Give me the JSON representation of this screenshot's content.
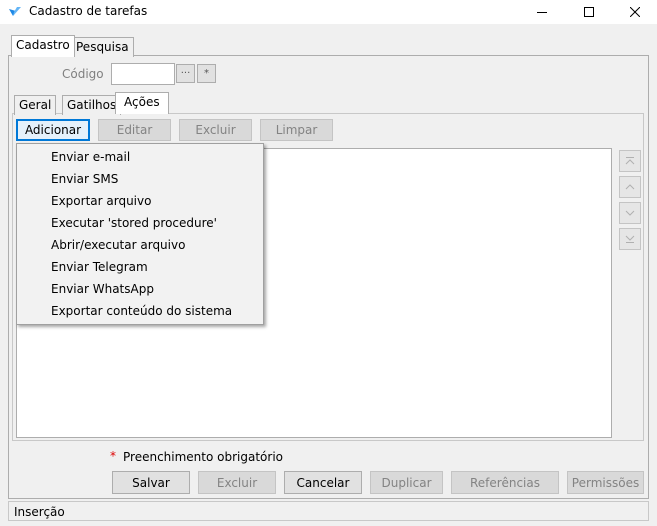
{
  "window": {
    "title": "Cadastro de tarefas",
    "icon": "app-logo-icon",
    "accent_color": "#0078d7"
  },
  "top_tabs": [
    {
      "label": "Cadastro",
      "active": true
    },
    {
      "label": "Pesquisa",
      "active": false
    }
  ],
  "codigo": {
    "label": "Código",
    "value": "",
    "ellipsis_button": "···",
    "star_button": "*"
  },
  "sub_tabs": [
    {
      "label": "Geral",
      "active": false
    },
    {
      "label": "Gatilhos",
      "active": false
    },
    {
      "label": "Ações",
      "active": true
    }
  ],
  "toolbar": {
    "adicionar": "Adicionar",
    "editar": "Editar",
    "excluir": "Excluir",
    "limpar": "Limpar"
  },
  "dropdown_menu": [
    "Enviar e-mail",
    "Enviar SMS",
    "Exportar arquivo",
    "Executar 'stored procedure'",
    "Abrir/executar arquivo",
    "Enviar Telegram",
    "Enviar WhatsApp",
    "Exportar conteúdo do sistema"
  ],
  "reorder_buttons": [
    "move-top-icon",
    "move-up-icon",
    "move-down-icon",
    "move-bottom-icon"
  ],
  "required_note": {
    "star": "*",
    "text": "Preenchimento obrigatório"
  },
  "bottom_buttons": {
    "salvar": "Salvar",
    "excluir": "Excluir",
    "cancelar": "Cancelar",
    "duplicar": "Duplicar",
    "referencias": "Referências",
    "permissoes": "Permissões"
  },
  "status": "Inserção"
}
